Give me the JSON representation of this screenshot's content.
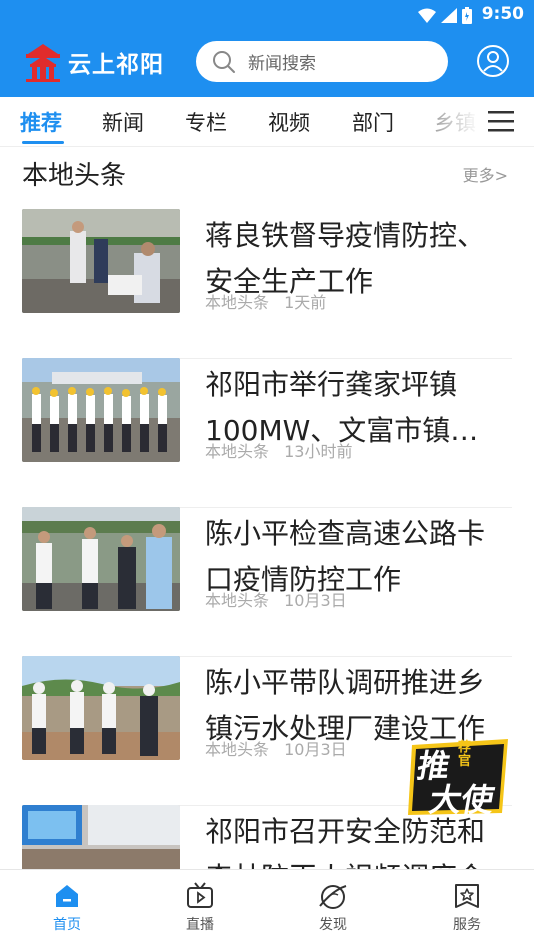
{
  "status_bar": {
    "time": "9:50"
  },
  "header": {
    "app_name": "云上祁阳",
    "search_placeholder": "新闻搜索"
  },
  "tabs": [
    {
      "label": "推荐",
      "active": true
    },
    {
      "label": "新闻"
    },
    {
      "label": "专栏"
    },
    {
      "label": "视频"
    },
    {
      "label": "部门"
    },
    {
      "label": "乡镇"
    }
  ],
  "section": {
    "title": "本地头条",
    "more": "更多>"
  },
  "news": [
    {
      "title": "蒋良铁督导疫情防控、安全生产工作",
      "source": "本地头条",
      "time": "1天前"
    },
    {
      "title": "祁阳市举行龚家坪镇100MW、文富市镇…",
      "source": "本地头条",
      "time": "13小时前"
    },
    {
      "title": "陈小平检查高速公路卡口疫情防控工作",
      "source": "本地头条",
      "time": "10月3日"
    },
    {
      "title": "陈小平带队调研推进乡镇污水处理厂建设工作",
      "source": "本地头条",
      "time": "10月3日"
    },
    {
      "title": "祁阳市召开安全防范和森林防灭火视频调度会",
      "source": "",
      "time": ""
    }
  ],
  "float_badge": {
    "line1": "推",
    "line2": "荐",
    "line3": "官",
    "line4": "大使"
  },
  "bottom_nav": [
    {
      "label": "首页",
      "active": true
    },
    {
      "label": "直播"
    },
    {
      "label": "发现"
    },
    {
      "label": "服务"
    }
  ],
  "colors": {
    "primary": "#1e8ff0",
    "text": "#222222",
    "meta": "#aaaaaa"
  }
}
